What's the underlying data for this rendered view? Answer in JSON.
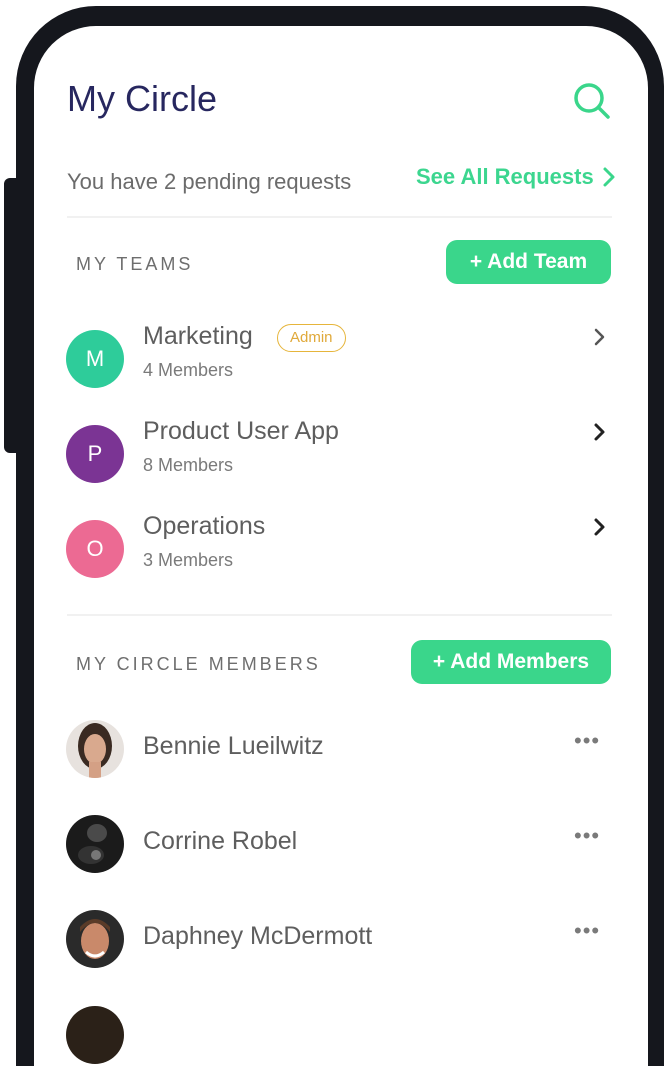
{
  "header": {
    "title": "My Circle",
    "search_icon": "search-icon"
  },
  "requests": {
    "text": "You have 2 pending requests",
    "link_label": "See All Requests"
  },
  "teams": {
    "section_label": "MY TEAMS",
    "add_label": "+ Add Team",
    "items": [
      {
        "initial": "M",
        "name": "Marketing",
        "members": "4 Members",
        "badge": "Admin",
        "color": "#2ecc9a"
      },
      {
        "initial": "P",
        "name": "Product User App",
        "members": "8 Members",
        "color": "#7b3494"
      },
      {
        "initial": "O",
        "name": "Operations",
        "members": "3 Members",
        "color": "#ec6a93"
      }
    ]
  },
  "circle": {
    "section_label": "MY CIRCLE MEMBERS",
    "add_label": "+ Add Members",
    "members": [
      {
        "name": "Bennie Lueilwitz",
        "menu": "•••"
      },
      {
        "name": "Corrine Robel",
        "menu": "•••"
      },
      {
        "name": "Daphney McDermott",
        "menu": "•••"
      }
    ]
  },
  "colors": {
    "accent": "#3ad68b",
    "title": "#27275f",
    "badge": "#e6b53b"
  }
}
